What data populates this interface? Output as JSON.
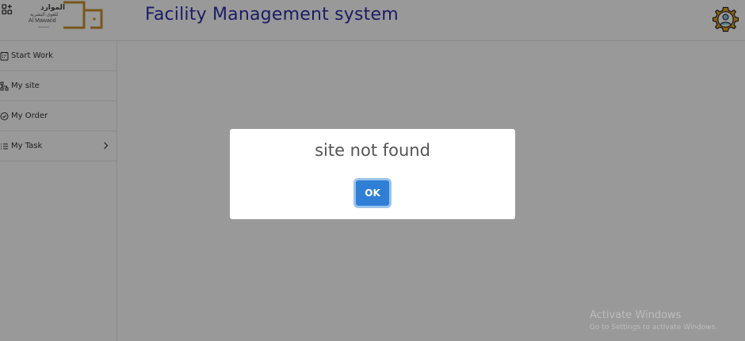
{
  "header": {
    "title": "Facility Management system",
    "logo": {
      "arabic_name": "الموارد",
      "arabic_sub": "للقوى البشرية",
      "english_name": "Al Mawarid",
      "english_sub": "Manpower"
    }
  },
  "sidebar": {
    "items": [
      {
        "label": "Start Work",
        "icon": "calendar-icon"
      },
      {
        "label": "My site",
        "icon": "sitemap-icon"
      },
      {
        "label": "My Order",
        "icon": "check-circle-icon"
      },
      {
        "label": "My Task",
        "icon": "list-icon",
        "has_children": true
      }
    ]
  },
  "modal": {
    "message": "site not found",
    "ok_label": "OK"
  },
  "watermark": {
    "line1": "Activate Windows",
    "line2": "Go to Settings to activate Windows."
  },
  "colors": {
    "title": "#2f2fa8",
    "ok_button": "#2f7fd6",
    "logo_gold": "#c9922e",
    "overlay": "rgba(0,0,0,0.40)"
  }
}
